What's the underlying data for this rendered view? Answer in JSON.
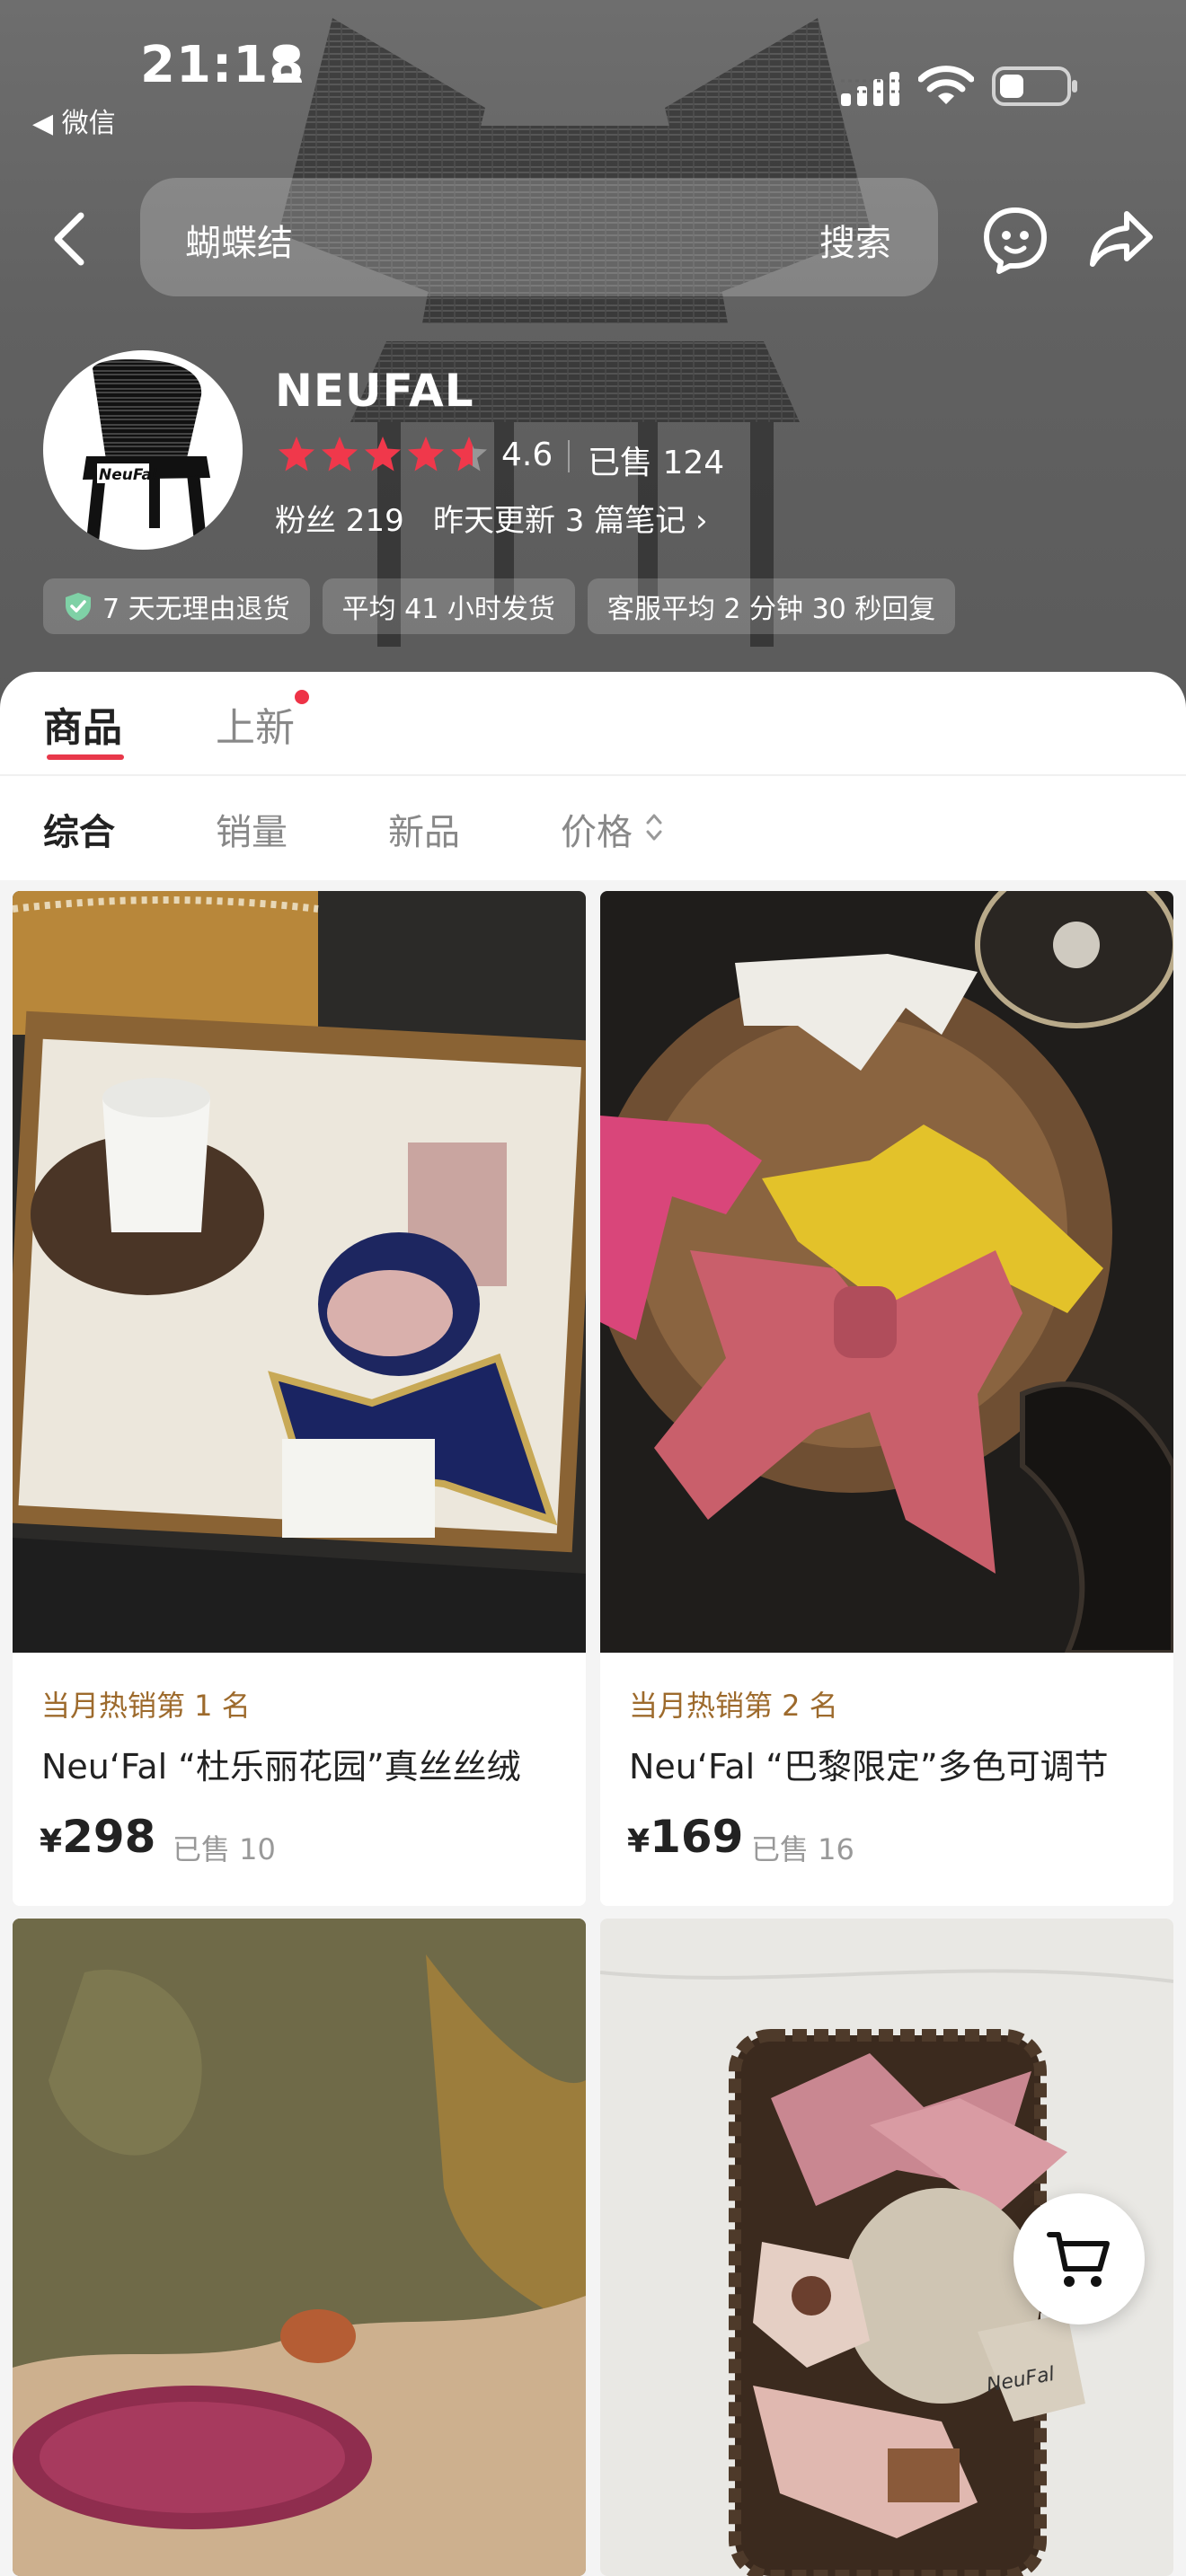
{
  "status_bar": {
    "time": "21:18",
    "back_app": "◀ 微信"
  },
  "search": {
    "query": "蝴蝶结",
    "button": "搜索"
  },
  "shop": {
    "name": "NEUFAL",
    "avatar_text": "NeuFal",
    "rating": "4.6",
    "rating_value": 4.6,
    "sold": "已售 124",
    "fans": "粉丝 219",
    "update_notes": "昨天更新 3 篇笔记 ›",
    "badges": [
      "7 天无理由退货",
      "平均 41 小时发货",
      "客服平均 2 分钟 30 秒回复"
    ]
  },
  "tabs": [
    "商品",
    "上新"
  ],
  "sort": [
    "综合",
    "销量",
    "新品",
    "价格"
  ],
  "products": [
    {
      "rank": "当月热销第 1 名",
      "title": "Neu‘Fal “杜乐丽花园”真丝丝绒",
      "currency": "¥",
      "price": "298",
      "sold": "已售 10"
    },
    {
      "rank": "当月热销第 2 名",
      "title": "Neu‘Fal “巴黎限定”多色可调节",
      "currency": "¥",
      "price": "169",
      "sold": "已售 16"
    }
  ],
  "colors": {
    "accent": "#e8384a",
    "rank": "#9d6a2c",
    "star": "#f0384b"
  },
  "icons": [
    "person-icon",
    "signal-icon",
    "wifi-icon",
    "battery-icon",
    "back-arrow-icon",
    "customer-service-icon",
    "share-icon",
    "star-icon",
    "shield-check-icon",
    "sort-arrows-icon",
    "shopping-cart-icon"
  ]
}
